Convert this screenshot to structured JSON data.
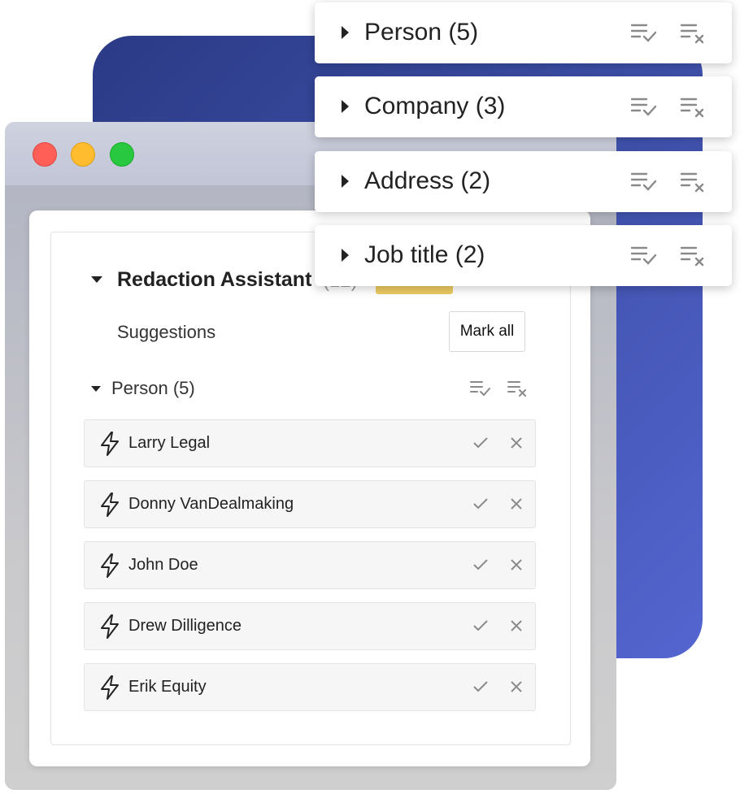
{
  "window": {
    "traffic_lights": {
      "close": "#ff5f57",
      "minimize": "#febc2e",
      "zoom": "#28c840"
    }
  },
  "panel": {
    "title": "Redaction Assistant",
    "count": "(12)",
    "suggestions_label": "Suggestions",
    "mark_all_label": "Mark all",
    "group": {
      "label": "Person (5)",
      "accept_all_icon": "list-check-icon",
      "reject_all_icon": "list-remove-icon"
    },
    "items": [
      {
        "name": "Larry Legal"
      },
      {
        "name": "Donny VanDealmaking"
      },
      {
        "name": "John Doe"
      },
      {
        "name": "Drew Dilligence"
      },
      {
        "name": "Erik Equity"
      }
    ]
  },
  "categories": [
    {
      "label": "Person (5)"
    },
    {
      "label": "Company (3)"
    },
    {
      "label": "Address (2)"
    },
    {
      "label": "Job title (2)"
    }
  ],
  "colors": {
    "brand_blue": "#3d4fa8",
    "highlight_yellow": "#eccb62",
    "icon_gray": "#8a8a8a"
  }
}
